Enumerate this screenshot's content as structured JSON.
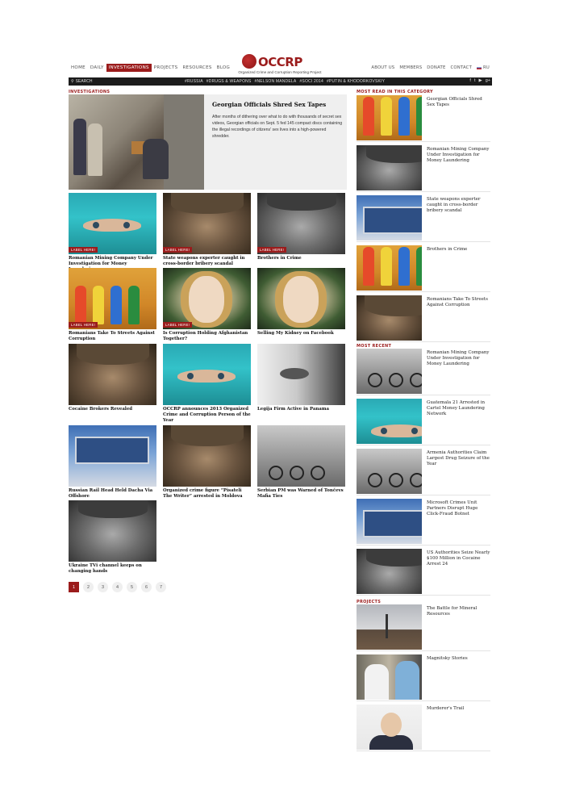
{
  "nav": {
    "left": [
      "HOME",
      "DAILY",
      "INVESTIGATIONS",
      "PROJECTS",
      "RESOURCES",
      "BLOG"
    ],
    "active": "INVESTIGATIONS",
    "right": [
      "ABOUT US",
      "MEMBERS",
      "DONATE",
      "CONTACT"
    ],
    "lang": "RU"
  },
  "logo": {
    "name": "OCCRP",
    "subtitle": "Organized Crime and Corruption Reporting Project"
  },
  "bar": {
    "search_label": "SEARCH",
    "tags": [
      "#RUSSIA",
      "#DRUGS & WEAPONS",
      "#NELSON MANDELA",
      "#SOCI 2014",
      "#PUTIN & KHODORKOVSKIY"
    ],
    "social_icons": [
      "facebook-icon",
      "twitter-icon",
      "youtube-icon",
      "google-plus-icon"
    ]
  },
  "colors": {
    "accent": "#9b1c1c",
    "bar": "#1c1c1c"
  },
  "investigations": {
    "heading": "INVESTIGATIONS",
    "feature": {
      "title": "Georgian Officials Shred Sex Tapes",
      "text": "After months of dithering over what to do with thousands of secret sex videos, Georgian officials on Sept. 5 fed 145 compact discs containing the illegal recordings of citizens' sex lives into a high-powered shredder."
    },
    "label_text": "LABEL HERE!",
    "cards": [
      {
        "title": "Romanian Mining Company Under Investigation for Money Laundering",
        "img": "teal",
        "label": true
      },
      {
        "title": "State weapons experter caught in cross-border bribery scandal",
        "img": "sepia",
        "label": true
      },
      {
        "title": "Brothers in Crime",
        "img": "bw",
        "label": true
      },
      {
        "title": "Romanians Take To Streets Against Corruption",
        "img": "orange",
        "label": true
      },
      {
        "title": "Is Corruption Holding Afghanistan Together?",
        "img": "girl",
        "label": true
      },
      {
        "title": "Selling My Kidney on Facebook",
        "img": "girl",
        "label": false
      },
      {
        "title": "Cocaine Brokers Revealed",
        "img": "sepia",
        "label": false
      },
      {
        "title": "OCCRP announces 2013 Organized Crime and Corruption Person of the Year",
        "img": "teal",
        "label": false
      },
      {
        "title": "Legija Firm Active in Panama",
        "img": "eye",
        "label": false
      },
      {
        "title": "Russian Rail Head Held Dacha Via Offshore",
        "img": "train",
        "label": false
      },
      {
        "title": "Organized crime figure “Pisateli The Writer” arrested in Moldova",
        "img": "sepia",
        "label": false
      },
      {
        "title": "Serbian PM was Warned of Tončevs Mafia Ties",
        "img": "bike",
        "label": false
      },
      {
        "title": "Ukraine TVi channel keeps on changing hands",
        "img": "bw",
        "label": false
      }
    ]
  },
  "pagination": [
    "1",
    "2",
    "3",
    "4",
    "5",
    "6",
    "7"
  ],
  "most_read": {
    "heading": "MOST READ IN THIS CATEGORY",
    "items": [
      {
        "title": "Georgian Officials Shred Sex Tapes",
        "img": "orange"
      },
      {
        "title": "Romanian Mining Company Under Investigation for Money Laundering",
        "img": "bw"
      },
      {
        "title": "State weapons experter caught in cross-border bribery scandal",
        "img": "train"
      },
      {
        "title": "Brothers in Crime",
        "img": "orange"
      },
      {
        "title": "Romanians Take To Streets Against Corruption",
        "img": "sepia"
      }
    ]
  },
  "most_recent": {
    "heading": "MOST RECENT",
    "items": [
      {
        "title": "Romanian Mining Company Under Investigation for Money Laundering",
        "img": "bike"
      },
      {
        "title": "Guatemala 21 Arrested in Cartel Money Laundering Network",
        "img": "teal"
      },
      {
        "title": "Armenia Authorities Claim Largest Drug Seizure of the Year",
        "img": "bike"
      },
      {
        "title": "Microsoft Crimes Unit Partners Disrupt Huge Click-Fraud Botnet",
        "img": "train"
      },
      {
        "title": "US Authorities Seize Nearly $100 Million in Cocaine Arrest 24",
        "img": "bw"
      }
    ]
  },
  "projects": {
    "heading": "PROJECTS",
    "items": [
      {
        "title": "The Battle for Mineral Resources",
        "img": "factory"
      },
      {
        "title": "Magnitsky Stories",
        "img": "men"
      },
      {
        "title": "Murderer's Trail",
        "img": "portrait"
      }
    ]
  }
}
